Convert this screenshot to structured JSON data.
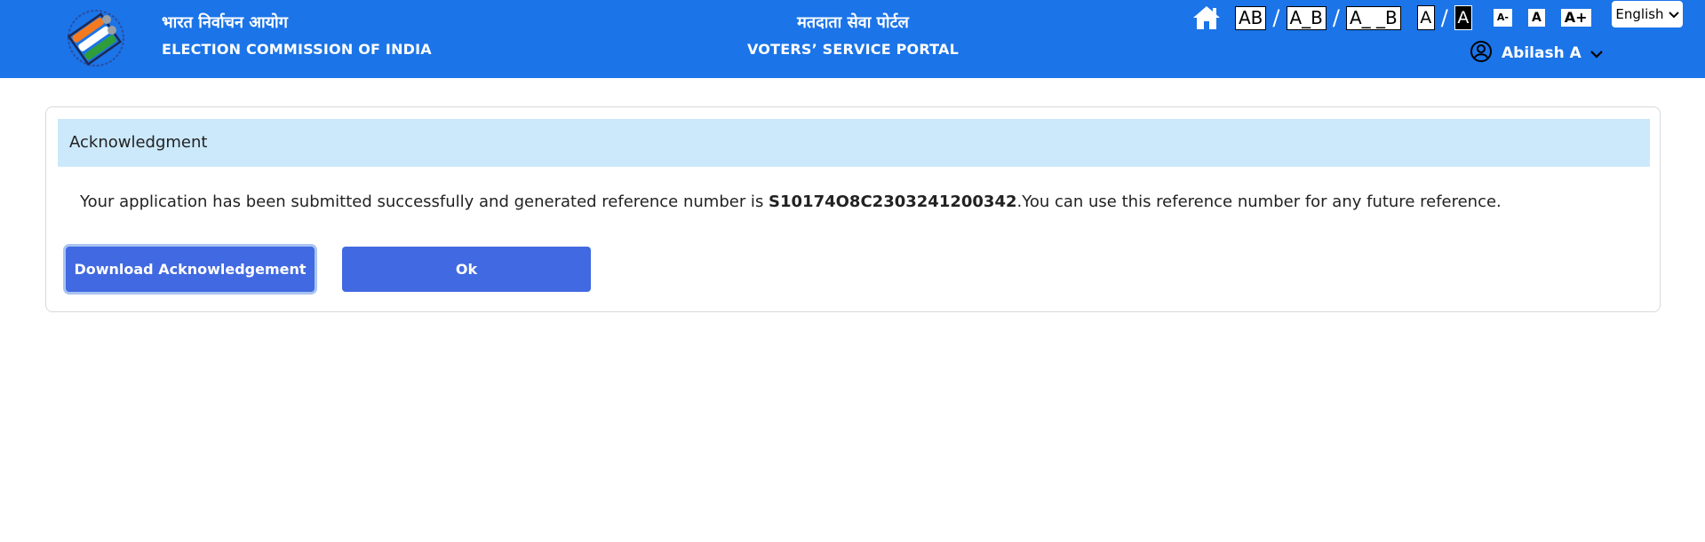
{
  "header": {
    "org_hindi": "भारत निर्वाचन आयोग",
    "org_english": "ELECTION COMMISSION OF INDIA",
    "portal_hindi": "मतदाता सेवा पोर्टल",
    "portal_english": "VOTERS’ SERVICE PORTAL",
    "bg_color": "#1b74e8"
  },
  "accessibility": {
    "spacing_options": [
      "AB",
      "A_B",
      "A_ _B"
    ],
    "separator": "/",
    "contrast_normal": "A",
    "contrast_high": "A",
    "font_decrease": "A-",
    "font_normal": "A",
    "font_increase": "A+"
  },
  "language": {
    "selected": "English"
  },
  "user": {
    "name": "Abilash A"
  },
  "acknowledgment": {
    "title": "Acknowledgment",
    "message_prefix": "Your application has been submitted successfully and generated reference number is ",
    "reference_number": "S10174O8C2303241200342",
    "message_suffix": ".You can use this reference number for any future reference.",
    "header_bg": "#cce9fb"
  },
  "buttons": {
    "download_label": "Download Acknowledgement",
    "ok_label": "Ok",
    "color": "#4169e1"
  },
  "icons": {
    "home": "home-icon",
    "user": "user-circle-icon",
    "chevron": "chevron-down-icon",
    "logo": "eci-logo-icon"
  }
}
